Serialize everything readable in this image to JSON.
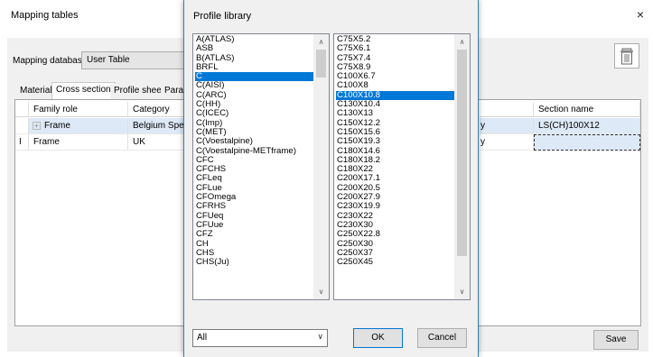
{
  "main_dialog": {
    "title": "Mapping tables",
    "close_glyph": "×",
    "database_label": "Mapping database",
    "database_value": "User Table",
    "tabs": [
      {
        "label": "Material",
        "active": false
      },
      {
        "label": "Cross section",
        "active": true
      },
      {
        "label": "Profile sheet",
        "active": false
      },
      {
        "label": "Param",
        "active": false
      }
    ],
    "grid": {
      "columns": [
        "Family role",
        "Category",
        "Section name"
      ],
      "rows": [
        {
          "marker": "",
          "family_role": "Frame",
          "category": "Belgium Specif",
          "partial": "y",
          "section_name": "LS(CH)100X12",
          "expandable": true
        },
        {
          "marker": "I",
          "family_role": "Frame",
          "category": "UK",
          "partial": "y",
          "section_name": "",
          "expandable": false
        }
      ]
    },
    "save_label": "Save",
    "icons": {
      "delete": "trash-icon",
      "expand": "plus-box-icon",
      "close": "close-icon"
    }
  },
  "profile_library": {
    "title": "Profile library",
    "families": [
      "A(ATLAS)",
      "ASB",
      "B(ATLAS)",
      "BRFL",
      "C",
      "C(AISI)",
      "C(ARC)",
      "C(HH)",
      "C(ICEC)",
      "C(Imp)",
      "C(MET)",
      "C(Voestalpine)",
      "C(Voestalpine-METframe)",
      "CFC",
      "CFCHS",
      "CFLeq",
      "CFLue",
      "CFOmega",
      "CFRHS",
      "CFUeq",
      "CFUue",
      "CFZ",
      "CH",
      "CHS",
      "CHS(Ju)"
    ],
    "selected_family": "C",
    "sections": [
      "C75X5.2",
      "C75X6.1",
      "C75X7.4",
      "C75X8.9",
      "C100X6.7",
      "C100X8",
      "C100X10.8",
      "C130X10.4",
      "C130X13",
      "C150X12.2",
      "C150X15.6",
      "C150X19.3",
      "C180X14.6",
      "C180X18.2",
      "C180X22",
      "C200X17.1",
      "C200X20.5",
      "C200X27.9",
      "C230X19.9",
      "C230X22",
      "C230X30",
      "C250X22.8",
      "C250X30",
      "C250X37",
      "C250X45"
    ],
    "selected_section": "C100X10.8",
    "filter_value": "All",
    "ok_label": "OK",
    "cancel_label": "Cancel",
    "scroll": {
      "families_thumb_fraction": 0.12,
      "sections_thumb_fraction": 0.88
    },
    "icons": {
      "scroll_up": "▲",
      "scroll_down": "▼",
      "dropdown": "chevron-down-icon"
    },
    "glyphs": {
      "scroll_up": "∧",
      "scroll_down": "∨",
      "dropdown": "∨"
    }
  },
  "colors": {
    "selection": "#0078d7",
    "row_highlight": "#dde9f6",
    "dialog_border": "#3c7fb1"
  }
}
